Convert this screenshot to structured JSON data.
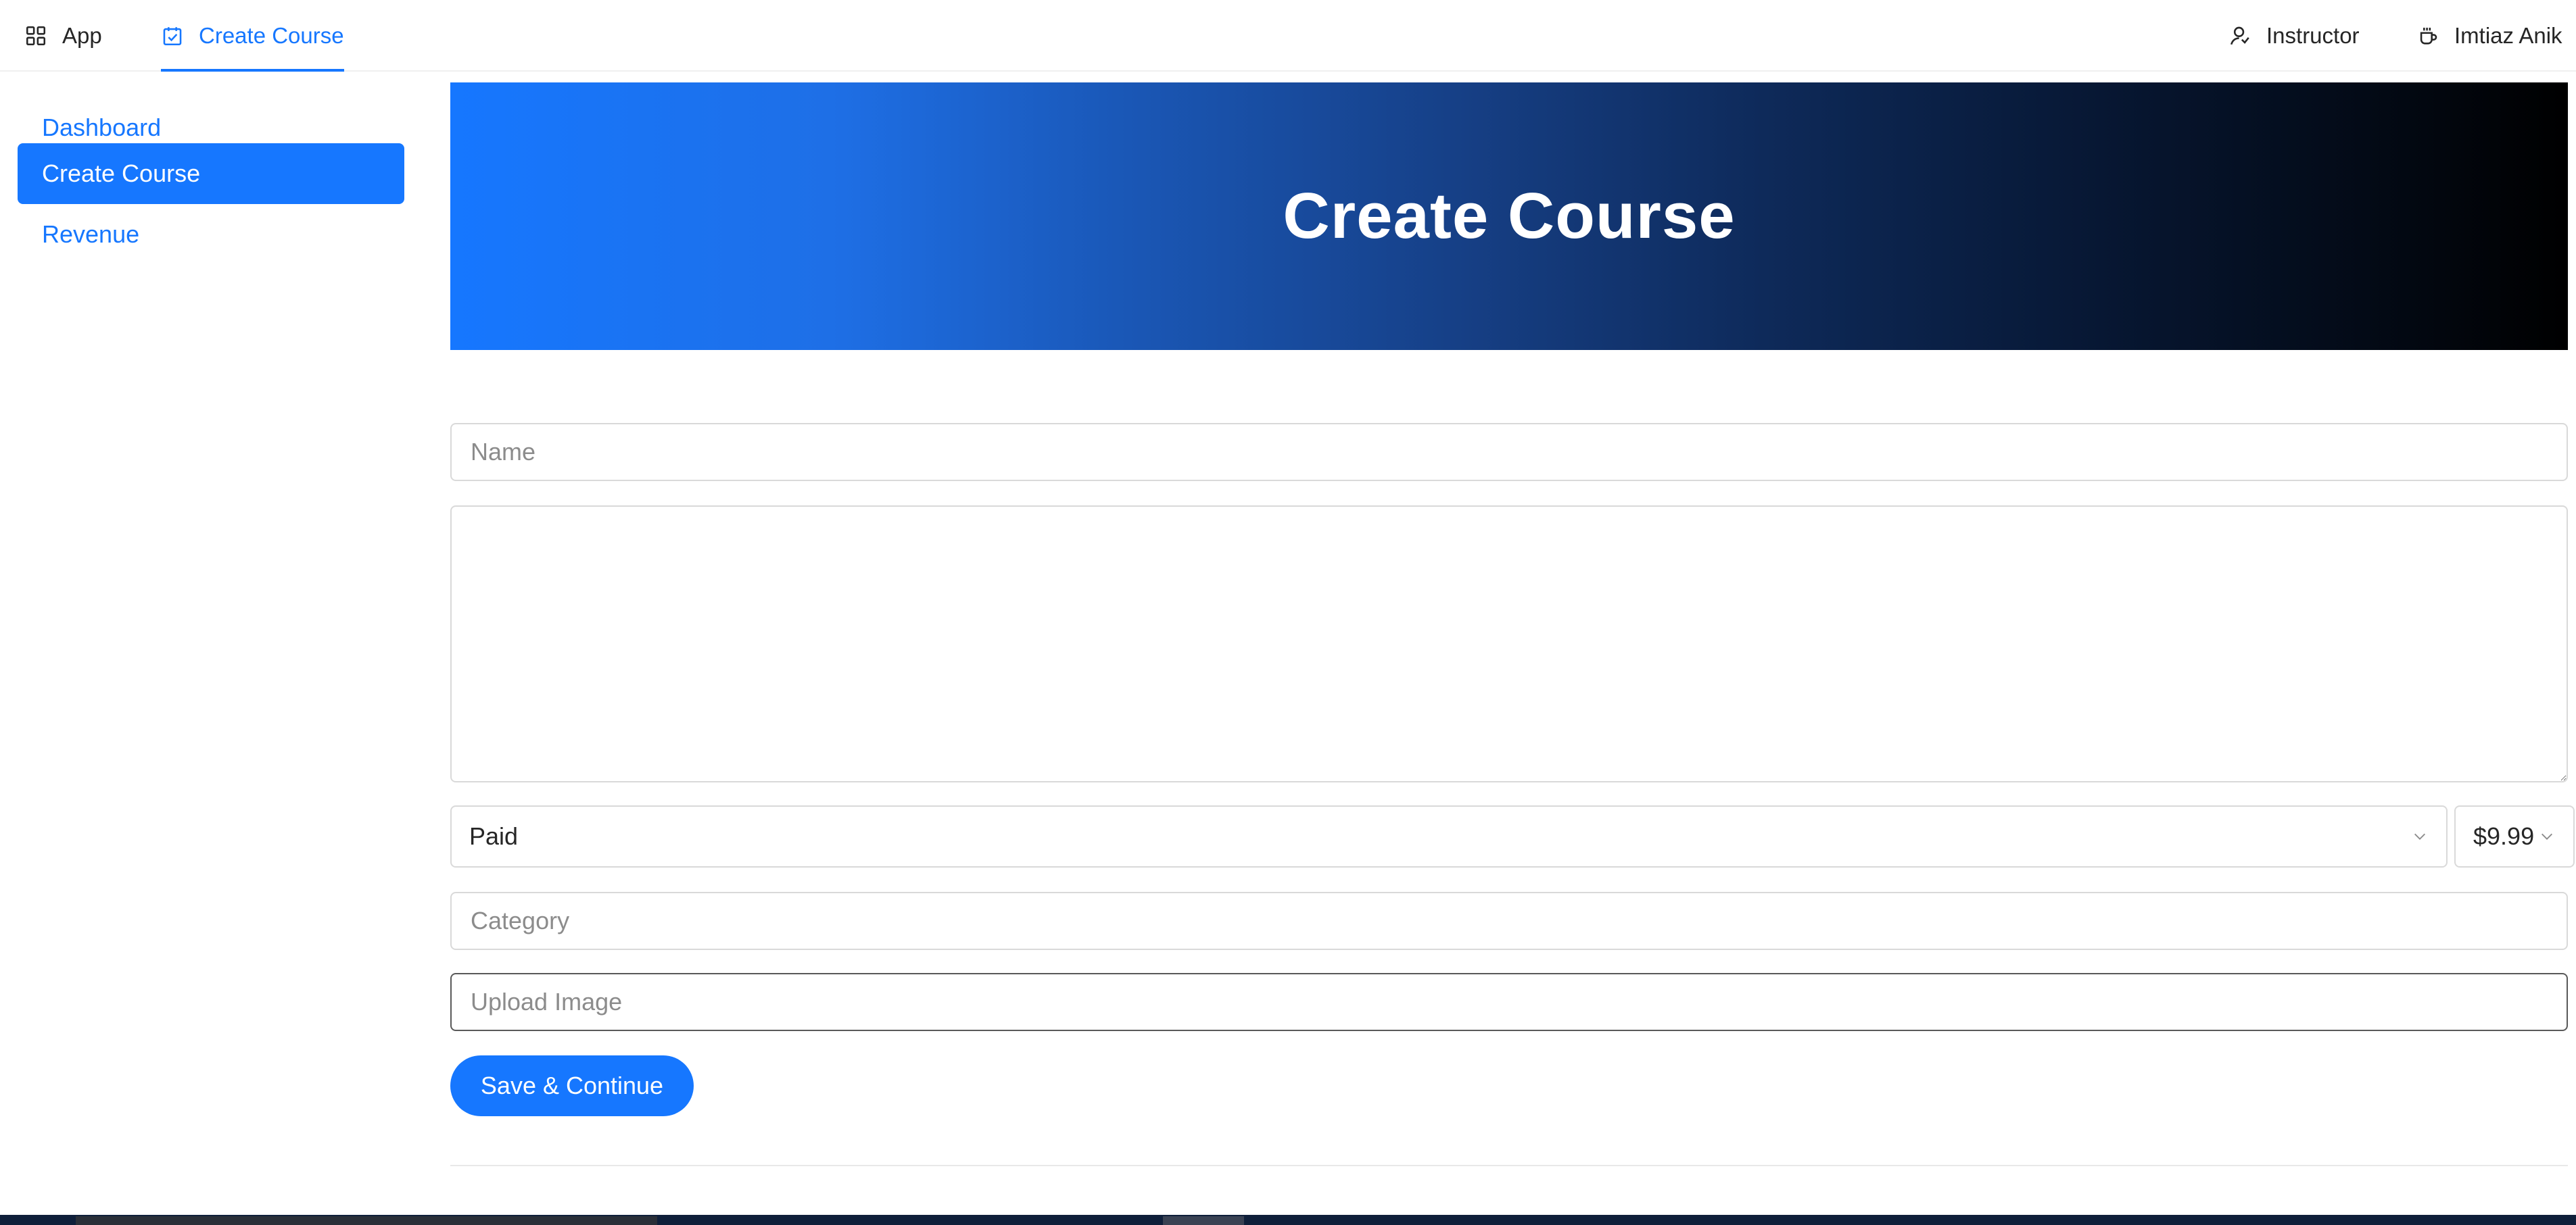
{
  "topnav": {
    "app_label": "App",
    "create_course_label": "Create Course",
    "instructor_label": "Instructor",
    "user_name": "Imtiaz Anik",
    "active_color": "#1677ff"
  },
  "sidebar": {
    "items": [
      {
        "label": "Dashboard",
        "active": false
      },
      {
        "label": "Create Course",
        "active": true
      },
      {
        "label": "Revenue",
        "active": false
      }
    ]
  },
  "banner": {
    "title": "Create Course",
    "gradient_from": "#1677ff",
    "gradient_to": "#000000"
  },
  "form": {
    "name_placeholder": "Name",
    "name_value": "",
    "description_value": "",
    "paid_select_value": "Paid",
    "price_select_value": "$9.99",
    "category_placeholder": "Category",
    "category_value": "",
    "upload_placeholder": "Upload Image",
    "upload_value": "",
    "save_button_label": "Save & Continue"
  },
  "icons": {
    "app": "app-grid-icon",
    "create_course": "calendar-check-icon",
    "instructor": "user-switch-icon",
    "user": "coffee-icon",
    "select_arrow": "chevron-down-icon"
  }
}
